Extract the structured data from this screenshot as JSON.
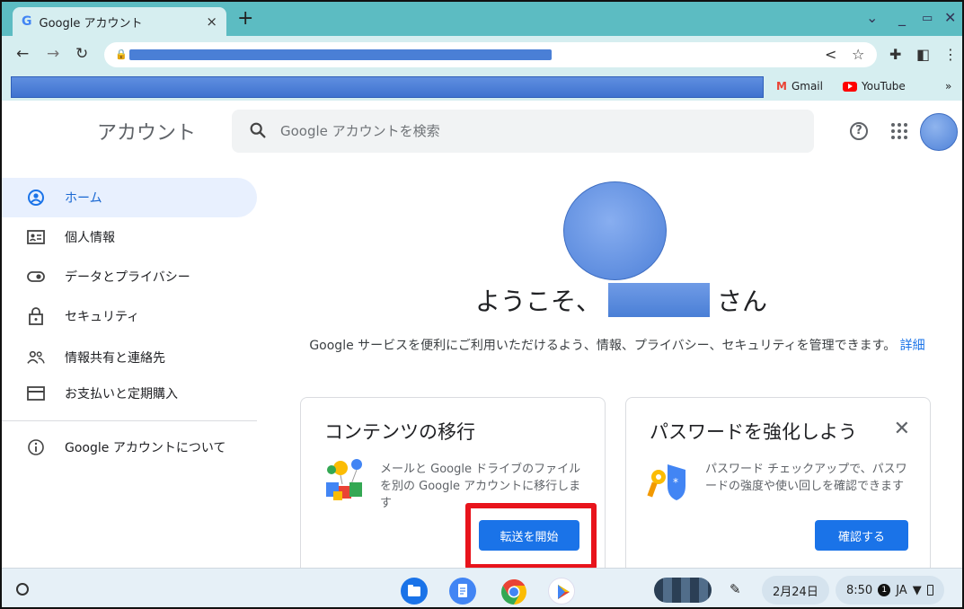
{
  "browser": {
    "tab_title": "Google アカウント",
    "tab_favicon": "G",
    "tab_close": "×",
    "new_tab": "+",
    "bookmarks": [
      {
        "label": "Gmail",
        "icon": "gmail-icon"
      },
      {
        "label": "YouTube",
        "icon": "youtube-icon"
      }
    ],
    "more_bookmarks": "»"
  },
  "header": {
    "title": "アカウント",
    "search_placeholder": "Google アカウントを検索"
  },
  "sidebar": {
    "items": [
      {
        "label": "ホーム",
        "icon": "home-icon",
        "active": true
      },
      {
        "label": "個人情報",
        "icon": "id-card-icon"
      },
      {
        "label": "データとプライバシー",
        "icon": "toggle-icon"
      },
      {
        "label": "セキュリティ",
        "icon": "lock-icon"
      },
      {
        "label": "情報共有と連絡先",
        "icon": "people-icon"
      },
      {
        "label": "お支払いと定期購入",
        "icon": "card-icon"
      }
    ],
    "about": {
      "label": "Google アカウントについて",
      "icon": "info-icon"
    }
  },
  "main": {
    "welcome_prefix": "ようこそ、",
    "welcome_suffix": "さん",
    "intro_text": "Google サービスを便利にご利用いただけるよう、情報、プライバシー、セキュリティを管理できます。",
    "intro_link": "詳細",
    "cards": [
      {
        "title": "コンテンツの移行",
        "description": "メールと Google ドライブのファイルを別の Google アカウントに移行します",
        "button": "転送を開始"
      },
      {
        "title": "パスワードを強化しよう",
        "description": "パスワード チェックアップで、パスワードの強度や使い回しを確認できます",
        "button": "確認する",
        "dismiss": "✕"
      }
    ]
  },
  "shelf": {
    "date": "2月24日",
    "time": "8:50",
    "notification_count": "1",
    "ime": "JA"
  },
  "colors": {
    "accent": "#1a73e8",
    "tabstrip": "#5cbcc2",
    "highlight": "#e8141c"
  }
}
